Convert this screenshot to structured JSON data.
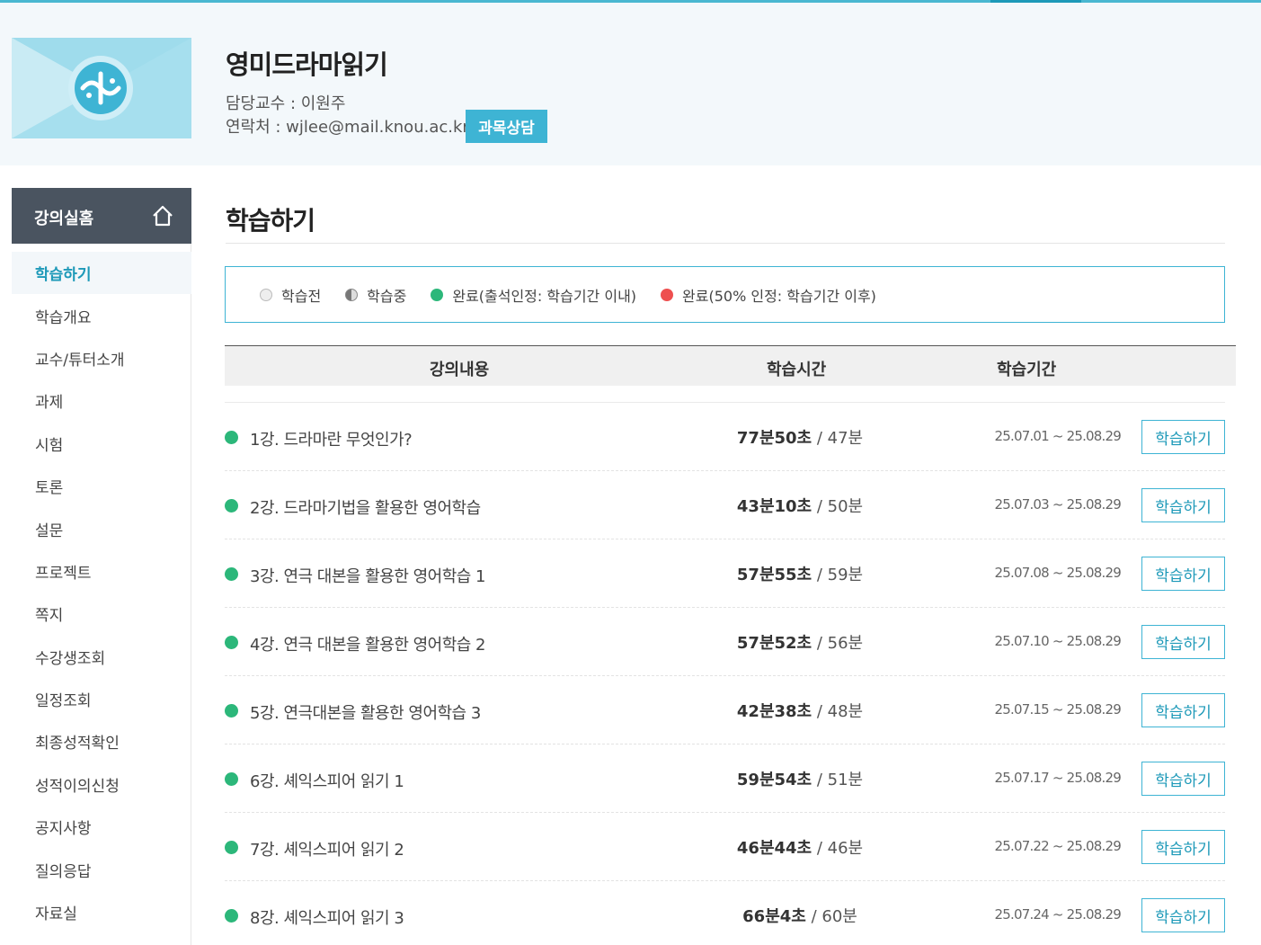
{
  "colors": {
    "accent": "#3eb4d4",
    "sidebar_header": "#4a5460",
    "done": "#2cb77a",
    "late": "#ee4f4f"
  },
  "course": {
    "title": "영미드라마읽기",
    "professor": "담당교수 : 이원주",
    "contact": "연락처 : wjlee@mail.knou.ac.kr",
    "consult_button": "과목상담"
  },
  "sidebar": {
    "title": "강의실홈",
    "home_icon": "home-icon",
    "items": [
      {
        "label": "학습하기",
        "active": true
      },
      {
        "label": "학습개요",
        "active": false
      },
      {
        "label": "교수/튜터소개",
        "active": false
      },
      {
        "label": "과제",
        "active": false
      },
      {
        "label": "시험",
        "active": false
      },
      {
        "label": "토론",
        "active": false
      },
      {
        "label": "설문",
        "active": false
      },
      {
        "label": "프로젝트",
        "active": false
      },
      {
        "label": "쪽지",
        "active": false
      },
      {
        "label": "수강생조회",
        "active": false
      },
      {
        "label": "일정조회",
        "active": false
      },
      {
        "label": "최종성적확인",
        "active": false
      },
      {
        "label": "성적이의신청",
        "active": false
      },
      {
        "label": "공지사항",
        "active": false
      },
      {
        "label": "질의응답",
        "active": false
      },
      {
        "label": "자료실",
        "active": false
      }
    ]
  },
  "main": {
    "title": "학습하기",
    "legend": [
      {
        "label": "학습전",
        "status": "before"
      },
      {
        "label": "학습중",
        "status": "progress"
      },
      {
        "label": "완료(출석인정: 학습기간 이내)",
        "status": "done"
      },
      {
        "label": "완료(50% 인정: 학습기간 이후)",
        "status": "late"
      }
    ],
    "columns": {
      "content": "강의내용",
      "time": "학습시간",
      "period": "학습기간"
    },
    "button_label": "학습하기",
    "lectures": [
      {
        "title": "1강. 드라마란 무엇인가?",
        "studied": "77분50초",
        "total": "/ 47분",
        "period": "25.07.01 ~ 25.08.29"
      },
      {
        "title": "2강. 드라마기법을 활용한 영어학습",
        "studied": "43분10초",
        "total": "/ 50분",
        "period": "25.07.03 ~ 25.08.29"
      },
      {
        "title": "3강. 연극 대본을 활용한 영어학습 1",
        "studied": "57분55초",
        "total": "/ 59분",
        "period": "25.07.08 ~ 25.08.29"
      },
      {
        "title": "4강. 연극 대본을 활용한 영어학습 2",
        "studied": "57분52초",
        "total": "/ 56분",
        "period": "25.07.10 ~ 25.08.29"
      },
      {
        "title": "5강. 연극대본을 활용한 영어학습 3",
        "studied": "42분38초",
        "total": "/ 48분",
        "period": "25.07.15 ~ 25.08.29"
      },
      {
        "title": "6강. 셰익스피어 읽기 1",
        "studied": "59분54초",
        "total": "/ 51분",
        "period": "25.07.17 ~ 25.08.29"
      },
      {
        "title": "7강. 셰익스피어 읽기 2",
        "studied": "46분44초",
        "total": "/ 46분",
        "period": "25.07.22 ~ 25.08.29"
      },
      {
        "title": "8강. 셰익스피어 읽기 3",
        "studied": "66분4초",
        "total": "/ 60분",
        "period": "25.07.24 ~ 25.08.29"
      }
    ]
  }
}
